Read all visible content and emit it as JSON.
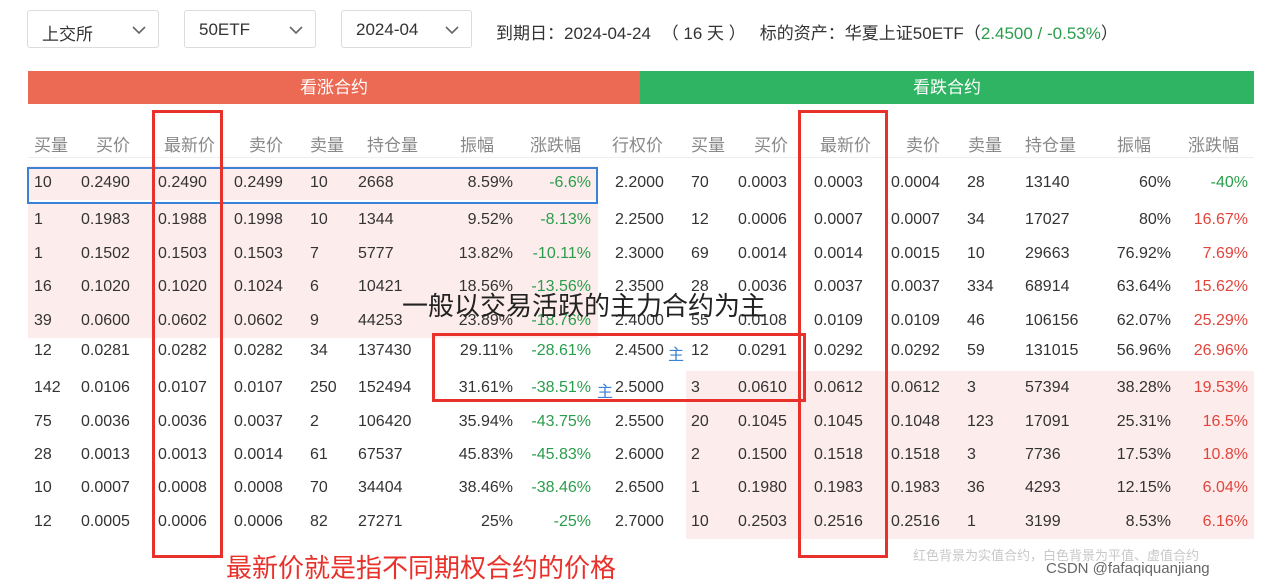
{
  "filters": {
    "exchange": "上交所",
    "underlying": "50ETF",
    "month": "2024-04"
  },
  "expiry": {
    "label": "到期日：",
    "date": "2024-04-24",
    "days": "（ 16 天 ）"
  },
  "asset": {
    "label": "标的资产：华夏上证50ETF（",
    "quote": "2.4500 / -0.53%",
    "close": "）"
  },
  "call_title": "看涨合约",
  "put_title": "看跌合约",
  "call_headers": [
    "买量",
    "买价",
    "最新价",
    "卖价",
    "卖量",
    "持仓量",
    "振幅",
    "涨跌幅"
  ],
  "strike_header": "行权价",
  "put_headers": [
    "买量",
    "买价",
    "最新价",
    "卖价",
    "卖量",
    "持仓量",
    "振幅",
    "涨跌幅"
  ],
  "rows": [
    {
      "c": [
        "10",
        "0.2490",
        "0.2490",
        "0.2499",
        "10",
        "2668",
        "8.59%",
        "-6.6%"
      ],
      "k": "2.2000",
      "p": [
        "70",
        "0.0003",
        "0.0003",
        "0.0004",
        "28",
        "13140",
        "60%",
        "-40%"
      ]
    },
    {
      "c": [
        "1",
        "0.1983",
        "0.1988",
        "0.1998",
        "10",
        "1344",
        "9.52%",
        "-8.13%"
      ],
      "k": "2.2500",
      "p": [
        "12",
        "0.0006",
        "0.0007",
        "0.0007",
        "34",
        "17027",
        "80%",
        "16.67%"
      ]
    },
    {
      "c": [
        "1",
        "0.1502",
        "0.1503",
        "0.1503",
        "7",
        "5777",
        "13.82%",
        "-10.11%"
      ],
      "k": "2.3000",
      "p": [
        "69",
        "0.0014",
        "0.0014",
        "0.0015",
        "10",
        "29663",
        "76.92%",
        "7.69%"
      ]
    },
    {
      "c": [
        "16",
        "0.1020",
        "0.1020",
        "0.1024",
        "6",
        "10421",
        "18.56%",
        "-13.56%"
      ],
      "k": "2.3500",
      "p": [
        "28",
        "0.0036",
        "0.0037",
        "0.0037",
        "334",
        "68914",
        "63.64%",
        "15.62%"
      ]
    },
    {
      "c": [
        "39",
        "0.0600",
        "0.0602",
        "0.0602",
        "9",
        "44253",
        "23.89%",
        "-18.76%"
      ],
      "k": "2.4000",
      "p": [
        "55",
        "0.0108",
        "0.0109",
        "0.0109",
        "46",
        "106156",
        "62.07%",
        "25.29%"
      ]
    },
    {
      "c": [
        "12",
        "0.0281",
        "0.0282",
        "0.0282",
        "34",
        "137430",
        "29.11%",
        "-28.61%"
      ],
      "k": "2.4500",
      "p": [
        "12",
        "0.0291",
        "0.0292",
        "0.0292",
        "59",
        "131015",
        "56.96%",
        "26.96%"
      ]
    },
    {
      "c": [
        "142",
        "0.0106",
        "0.0107",
        "0.0107",
        "250",
        "152494",
        "31.61%",
        "-38.51%"
      ],
      "k": "2.5000",
      "p": [
        "3",
        "0.0610",
        "0.0612",
        "0.0612",
        "3",
        "57394",
        "38.28%",
        "19.53%"
      ]
    },
    {
      "c": [
        "75",
        "0.0036",
        "0.0036",
        "0.0037",
        "2",
        "106420",
        "35.94%",
        "-43.75%"
      ],
      "k": "2.5500",
      "p": [
        "20",
        "0.1045",
        "0.1045",
        "0.1048",
        "123",
        "17091",
        "25.31%",
        "16.5%"
      ]
    },
    {
      "c": [
        "28",
        "0.0013",
        "0.0013",
        "0.0014",
        "61",
        "67537",
        "45.83%",
        "-45.83%"
      ],
      "k": "2.6000",
      "p": [
        "2",
        "0.1500",
        "0.1518",
        "0.1518",
        "3",
        "7736",
        "17.53%",
        "10.8%"
      ]
    },
    {
      "c": [
        "10",
        "0.0007",
        "0.0008",
        "0.0008",
        "70",
        "34404",
        "38.46%",
        "-38.46%"
      ],
      "k": "2.6500",
      "p": [
        "1",
        "0.1980",
        "0.1983",
        "0.1983",
        "36",
        "4293",
        "12.15%",
        "6.04%"
      ]
    },
    {
      "c": [
        "12",
        "0.0005",
        "0.0006",
        "0.0006",
        "82",
        "27271",
        "25%",
        "-25%"
      ],
      "k": "2.7000",
      "p": [
        "10",
        "0.2503",
        "0.2516",
        "0.2516",
        "1",
        "3199",
        "8.53%",
        "6.16%"
      ]
    }
  ],
  "main_marker": "主",
  "annotation_main": "一般以交易活跃的主力合约为主",
  "annotation_price": "最新价就是指不同期权合约的价格",
  "legend_note": "红色背景为实值合约，白色背景为平值、虚值合约",
  "watermark": "CSDN @fafaqiquanjiang",
  "colors": {
    "call_bar": "#ec6a53",
    "put_bar": "#2fb463",
    "itm_bg": "#fdecec",
    "up": "#e0443c",
    "down": "#2a9d4b",
    "annotation": "#e8312a"
  }
}
